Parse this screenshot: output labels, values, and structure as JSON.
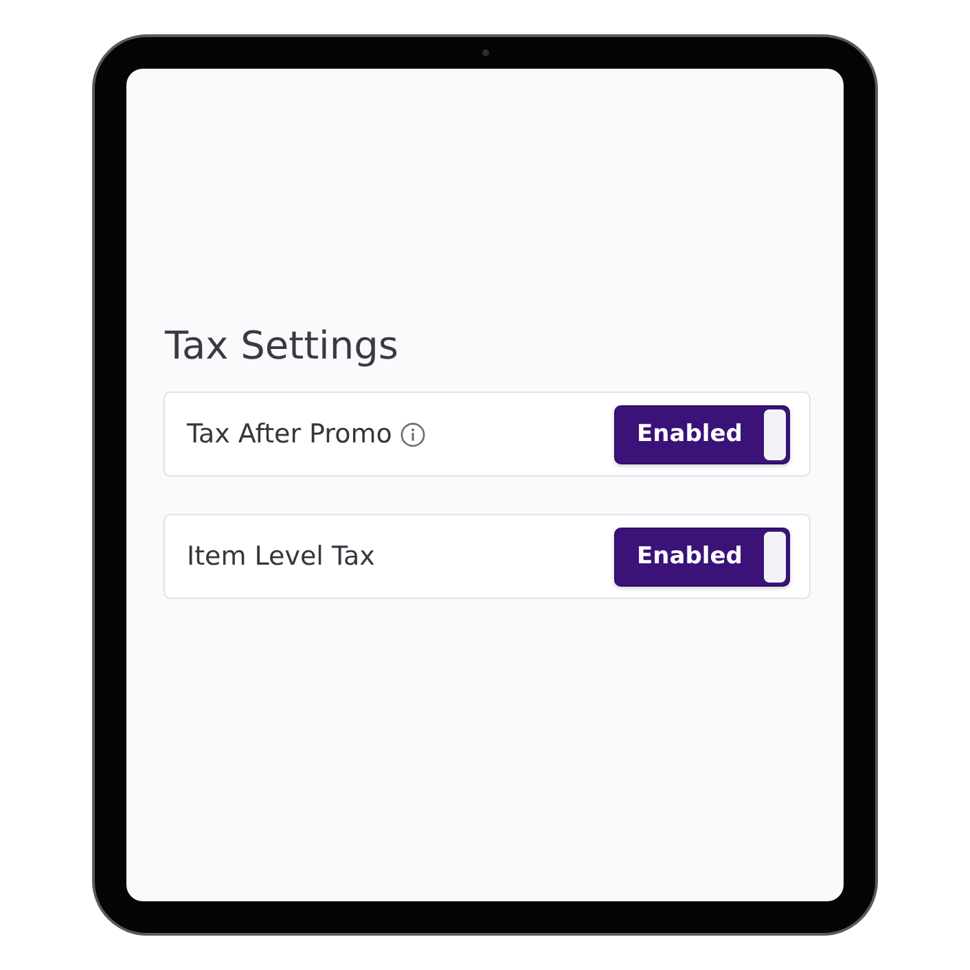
{
  "screen": {
    "title": "Tax Settings",
    "settings": [
      {
        "label": "Tax After Promo",
        "info": true,
        "on": true,
        "state_label": "Enabled"
      },
      {
        "label": "Item Level Tax",
        "info": false,
        "on": true,
        "state_label": "Enabled"
      }
    ]
  }
}
